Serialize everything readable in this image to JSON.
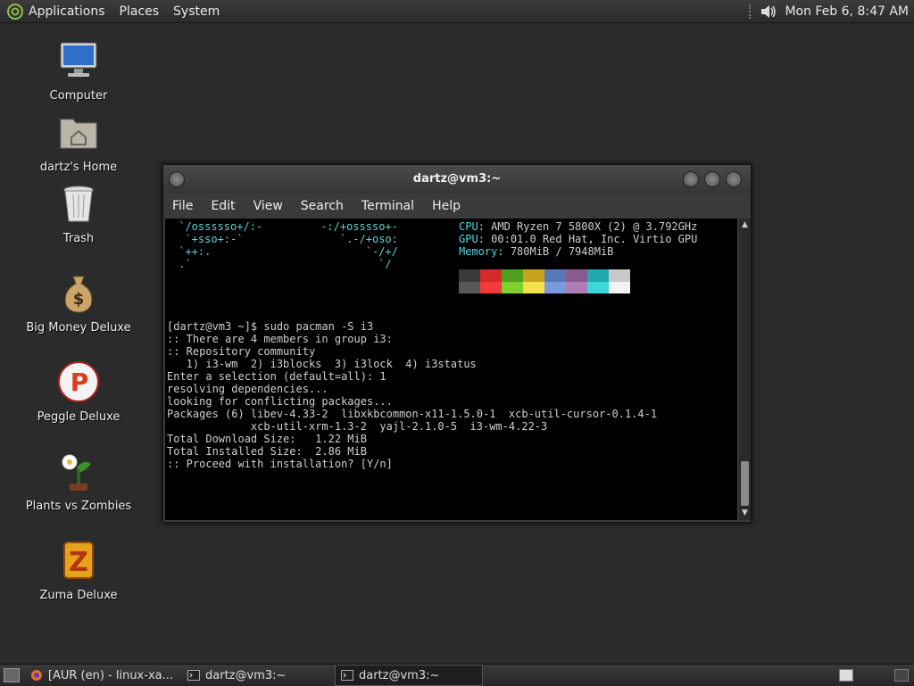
{
  "top_panel": {
    "menus": [
      "Applications",
      "Places",
      "System"
    ],
    "clock": "Mon Feb  6,  8:47 AM",
    "icons": {
      "logo": "mate-logo-icon",
      "volume": "volume-icon"
    }
  },
  "desktop_icons": [
    {
      "label": "Computer",
      "icon": "computer-icon"
    },
    {
      "label": "dartz's Home",
      "icon": "home-folder-icon"
    },
    {
      "label": "Trash",
      "icon": "trash-icon"
    },
    {
      "label": "Big Money Deluxe",
      "icon": "money-bag-icon"
    },
    {
      "label": "Peggle Deluxe",
      "icon": "peggle-icon"
    },
    {
      "label": "Plants vs Zombies",
      "icon": "plants-icon"
    },
    {
      "label": "Zuma Deluxe",
      "icon": "zuma-icon"
    }
  ],
  "terminal": {
    "title": "dartz@vm3:~",
    "menu": [
      "File",
      "Edit",
      "View",
      "Search",
      "Terminal",
      "Help"
    ],
    "logo_art": [
      " `/ossssso+/:-         -:/+osssso+-",
      "  `+sso+:-`               `.-/+oso:",
      " `++:.                        `-/+/",
      " .`                             `/"
    ],
    "sysinfo": [
      {
        "key": "CPU",
        "value": "AMD Ryzen 7 5800X (2) @ 3.792GHz"
      },
      {
        "key": "GPU",
        "value": "00:01.0 Red Hat, Inc. Virtio GPU"
      },
      {
        "key": "Memory",
        "value": "780MiB / 7948MiB"
      }
    ],
    "palette": [
      "#3a3a3a",
      "#d42a2a",
      "#4ea01e",
      "#c8a41c",
      "#5879b8",
      "#8a5a8e",
      "#22a8b0",
      "#c8c8c8",
      "#585858",
      "#f23a3a",
      "#7ad22a",
      "#f5e24a",
      "#7a9ade",
      "#b07cb6",
      "#3ad8d8",
      "#f2f2f2"
    ],
    "lines": [
      "[dartz@vm3 ~]$ sudo pacman -S i3",
      ":: There are 4 members in group i3:",
      ":: Repository community",
      "   1) i3-wm  2) i3blocks  3) i3lock  4) i3status",
      "",
      "Enter a selection (default=all): 1",
      "resolving dependencies...",
      "looking for conflicting packages...",
      "",
      "Packages (6) libev-4.33-2  libxkbcommon-x11-1.5.0-1  xcb-util-cursor-0.1.4-1",
      "             xcb-util-xrm-1.3-2  yajl-2.1.0-5  i3-wm-4.22-3",
      "",
      "Total Download Size:   1.22 MiB",
      "Total Installed Size:  2.86 MiB",
      "",
      ":: Proceed with installation? [Y/n]"
    ]
  },
  "taskbar": {
    "tasks": [
      {
        "label": "[AUR (en) - linux-xa...",
        "icon": "firefox-icon",
        "active": false
      },
      {
        "label": "dartz@vm3:~",
        "icon": "terminal-icon",
        "active": false
      },
      {
        "label": "dartz@vm3:~",
        "icon": "terminal-icon",
        "active": true
      }
    ]
  }
}
